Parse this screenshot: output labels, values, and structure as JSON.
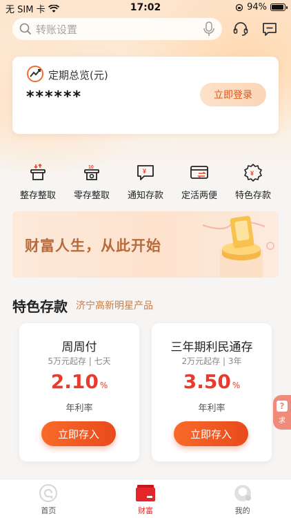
{
  "status_bar": {
    "carrier": "无 SIM 卡",
    "time": "17:02",
    "battery": "94%",
    "battery_level": 0.94
  },
  "search": {
    "placeholder": "转账设置"
  },
  "overview": {
    "title": "定期总览(元)",
    "amount": "******",
    "login_label": "立即登录"
  },
  "categories": [
    {
      "label": "整存整取",
      "icon": "lump-sum-deposit-icon"
    },
    {
      "label": "零存整取",
      "icon": "installment-deposit-icon"
    },
    {
      "label": "通知存款",
      "icon": "notice-deposit-icon"
    },
    {
      "label": "定活两便",
      "icon": "flexible-deposit-icon"
    },
    {
      "label": "特色存款",
      "icon": "featured-deposit-icon"
    }
  ],
  "banner": {
    "text": "财富人生，从此开始"
  },
  "section": {
    "title": "特色存款",
    "subtitle": "济宁高新明星产品"
  },
  "products": [
    {
      "name": "周周付",
      "desc": "5万元起存 | 七天",
      "rate": "2.10",
      "unit": "%",
      "rate_label": "年利率",
      "button": "立即存入"
    },
    {
      "name": "三年期利民通存",
      "desc": "2万元起存 | 3年",
      "rate": "3.50",
      "unit": "%",
      "rate_label": "年利率",
      "button": "立即存入"
    }
  ],
  "float_tab": {
    "label": "求"
  },
  "tabbar": [
    {
      "label": "首页",
      "icon": "home-icon"
    },
    {
      "label": "财富",
      "icon": "wealth-icon"
    },
    {
      "label": "我的",
      "icon": "profile-icon"
    }
  ],
  "colors": {
    "accent": "#e63c2f",
    "button": "#f96a2a",
    "sub": "#c77c48"
  }
}
